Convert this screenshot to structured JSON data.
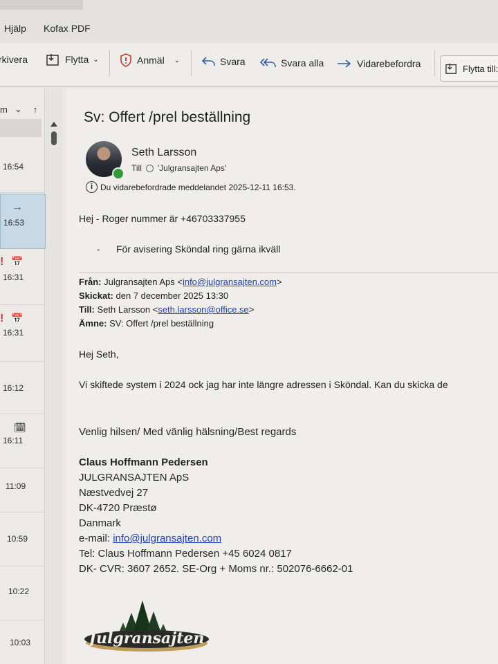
{
  "menu": {
    "help": "Hjälp",
    "kofax": "Kofax PDF"
  },
  "ribbon": {
    "archive": "rkivera",
    "move": "Flytta",
    "report": "Anmäl",
    "reply": "Svara",
    "reply_all": "Svara alla",
    "forward": "Vidarebefordra",
    "move_to": "Flytta till:"
  },
  "list": {
    "sort_label": "m",
    "times": [
      "16:54",
      "16:53",
      "16:31",
      "16:31",
      "16:12",
      "16:11",
      "11:09",
      "10:59",
      "10:22",
      "10:03"
    ]
  },
  "message": {
    "subject": "Sv: Offert /prel beställning",
    "sender": "Seth Larsson",
    "to_label": "Till",
    "to_value": "'Julgransajten Aps'",
    "info": "Du vidarebefordrade meddelandet 2025-12-11 16:53.",
    "line1": "Hej  - Roger nummer är +46703337955",
    "bullet_mark": "-",
    "bullet": "För avisering Sköndal ring gärna ikväll",
    "from_label": "Från:",
    "from_name": "Julgransajten Aps <",
    "from_email": "info@julgransajten.com",
    "from_close": ">",
    "sent_label": "Skickat:",
    "sent_value": "den 7 december 2025 13:30",
    "to2_label": "Till:",
    "to2_name": "Seth Larsson <",
    "to2_email": "seth.larsson@office.se",
    "to2_close": ">",
    "subject_label": "Ämne:",
    "subject_value": "SV: Offert /prel beställning",
    "greeting": "Hej Seth,",
    "body": "Vi skiftede system i 2024 ock jag har inte längre adressen i Sköndal. Kan du skicka de",
    "regards": "Venlig hilsen/ Med vänlig hälsning/Best regards",
    "sig_name": "Claus Hoffmann Pedersen",
    "sig_company": "JULGRANSAJTEN ApS",
    "sig_street": "Næstvedvej 27",
    "sig_city": "DK-4720 Præstø",
    "sig_country": "Danmark",
    "sig_email_label": "e-mail: ",
    "sig_email": "info@julgransajten.com",
    "sig_tel": "Tel: Claus Hoffmann Pedersen +45 6024 0817",
    "sig_cvr": "DK- CVR: 3607 2652.  SE-Org + Moms nr.: 502076-6662-01",
    "logo_text": "Julgransajten"
  },
  "colors": {
    "link": "#1d3fbf",
    "selected_row": "#c7d8e6",
    "presence": "#2e9d3a"
  }
}
